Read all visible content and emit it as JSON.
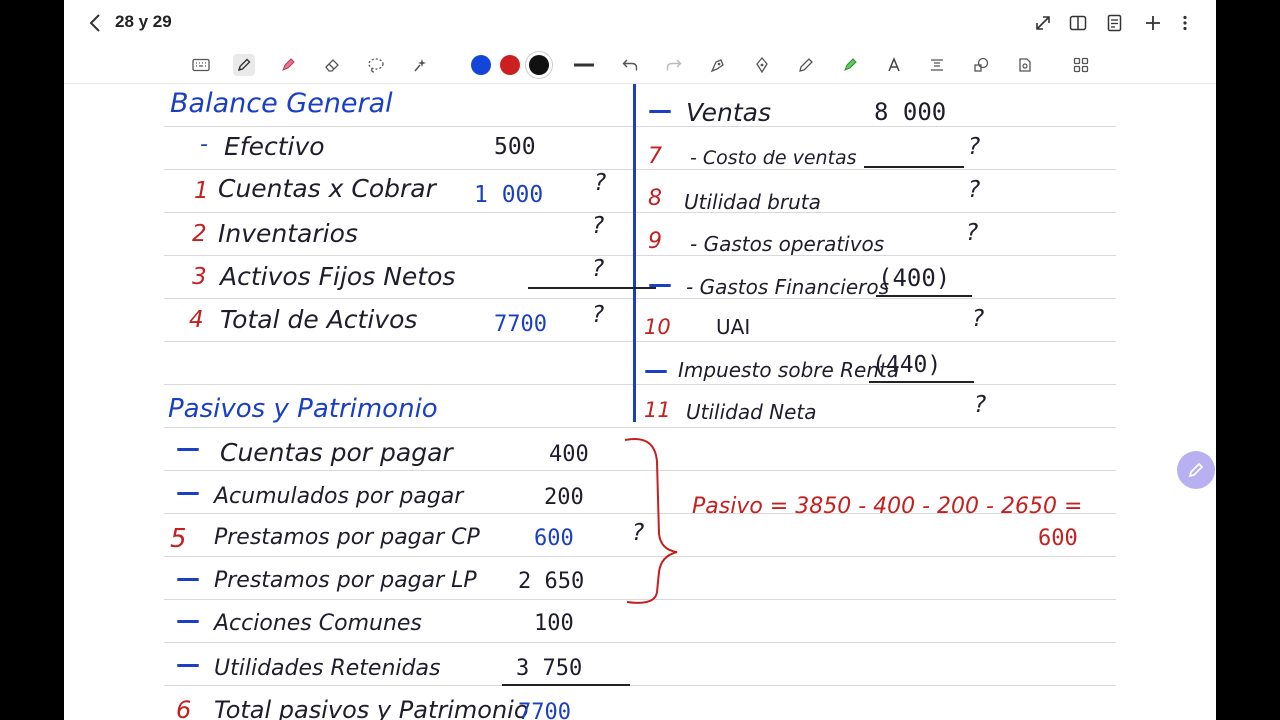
{
  "header": {
    "title": "28 y 29",
    "icons": [
      "back-icon",
      "expand-icon",
      "book-icon",
      "pages-icon",
      "add-icon",
      "more-icon"
    ]
  },
  "toolbar": {
    "tools": [
      "keyboard-icon",
      "pen-icon",
      "highlighter-icon",
      "eraser-icon",
      "lasso-icon",
      "laser-icon",
      "undo-icon",
      "redo-icon",
      "shape-pen-icon",
      "fountain-pen-icon",
      "ballpoint-icon",
      "marker-icon",
      "text-icon",
      "scan-text-icon",
      "shapes-icon",
      "sticker-icon",
      "grid-icon"
    ],
    "colors": {
      "blue": "#1346d8",
      "red": "#cc1f1f",
      "black": "#111111"
    },
    "selected_color": "black"
  },
  "note": {
    "balance": {
      "title": "Balance General",
      "rows": [
        {
          "marker": "-",
          "label": "Efectivo",
          "value": "500",
          "q": ""
        },
        {
          "marker": "1",
          "label": "Cuentas x Cobrar",
          "value": "1 000",
          "q": "?"
        },
        {
          "marker": "2",
          "label": "Inventarios",
          "value": "",
          "q": "?"
        },
        {
          "marker": "3",
          "label": "Activos Fijos Netos",
          "value": "",
          "q": "?"
        },
        {
          "marker": "4",
          "label": "Total de Activos",
          "value": "7700",
          "q": "?"
        }
      ]
    },
    "pasivos": {
      "title": "Pasivos y Patrimonio",
      "rows": [
        {
          "marker": "—",
          "label": "Cuentas por pagar",
          "value": "400",
          "q": ""
        },
        {
          "marker": "—",
          "label": "Acumulados por pagar",
          "value": "200",
          "q": ""
        },
        {
          "marker": "5",
          "label": "Prestamos por pagar CP",
          "value": "600",
          "q": "?"
        },
        {
          "marker": "—",
          "label": "Prestamos por pagar LP",
          "value": "2 650",
          "q": ""
        },
        {
          "marker": "—",
          "label": "Acciones Comunes",
          "value": "100",
          "q": ""
        },
        {
          "marker": "—",
          "label": "Utilidades Retenidas",
          "value": "3 750",
          "q": ""
        },
        {
          "marker": "6",
          "label": "Total pasivos y Patrimonio",
          "value": "7700",
          "q": ""
        }
      ]
    },
    "income": {
      "rows": [
        {
          "marker": "—",
          "label": "Ventas",
          "value": "8 000",
          "q": ""
        },
        {
          "marker": "7",
          "label": "- Costo de ventas",
          "value": "",
          "q": "?"
        },
        {
          "marker": "8",
          "label": "Utilidad bruta",
          "value": "",
          "q": "?"
        },
        {
          "marker": "9",
          "label": "- Gastos operativos",
          "value": "",
          "q": "?"
        },
        {
          "marker": "—",
          "label": "- Gastos Financieros",
          "value": "(400)",
          "q": ""
        },
        {
          "marker": "10",
          "label": "UAI",
          "value": "",
          "q": "?"
        },
        {
          "marker": "—",
          "label": "Impuesto sobre Renta",
          "value": "(440)",
          "q": ""
        },
        {
          "marker": "11",
          "label": "Utilidad Neta",
          "value": "",
          "q": "?"
        }
      ]
    },
    "calc": {
      "line1": "Pasivo = 3850 - 400 - 200 - 2650 =",
      "line2": "600"
    }
  }
}
